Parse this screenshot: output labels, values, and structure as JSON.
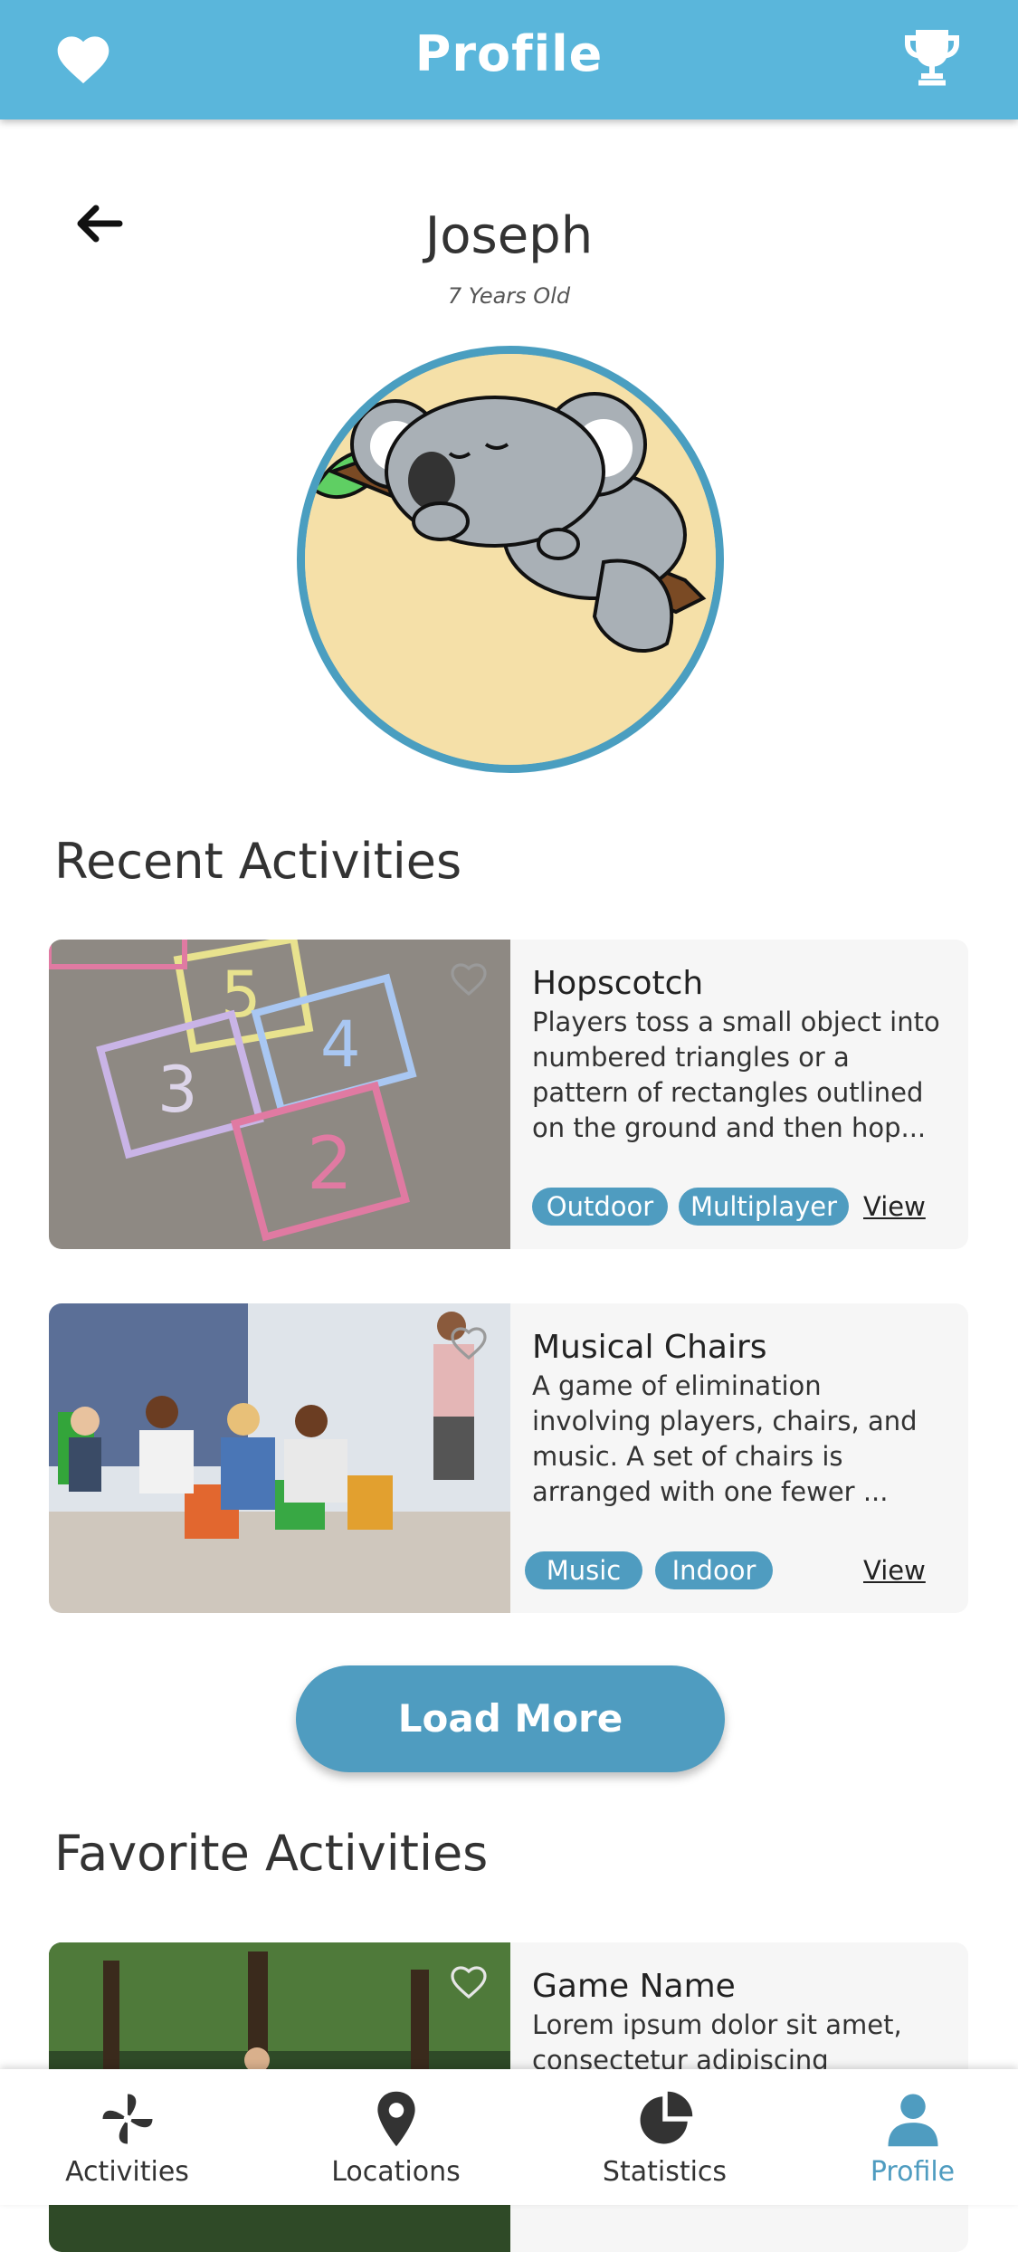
{
  "header": {
    "title": "Profile"
  },
  "profile": {
    "name": "Joseph",
    "age": "7 Years Old"
  },
  "recent": {
    "title": "Recent Activities",
    "cards": [
      {
        "title": "Hopscotch",
        "description": "Players toss a small object into numbered triangles or a pattern of rectangles outlined on the ground and then hop...",
        "tags": [
          "Outdoor",
          "Multiplayer"
        ],
        "view": "View"
      },
      {
        "title": "Musical Chairs",
        "description": "A game of elimination involving players, chairs, and music. A set of chairs is arranged with one fewer ...",
        "tags": [
          "Music",
          "Indoor"
        ],
        "view": "View"
      }
    ]
  },
  "load_more": "Load More",
  "favorites": {
    "title": "Favorite Activities",
    "cards": [
      {
        "title": "Game Name",
        "description": "Lorem ipsum dolor sit amet, consectetur adipiscing"
      }
    ]
  },
  "nav": {
    "items": [
      {
        "label": "Activities",
        "icon": "pinwheel-icon"
      },
      {
        "label": "Locations",
        "icon": "map-pin-icon"
      },
      {
        "label": "Statistics",
        "icon": "pie-chart-icon"
      },
      {
        "label": "Profile",
        "icon": "user-icon"
      }
    ],
    "active_index": 3
  },
  "colors": {
    "header": "#5ab6db",
    "accent": "#4f9cc0",
    "ring": "#4a9ec0"
  }
}
